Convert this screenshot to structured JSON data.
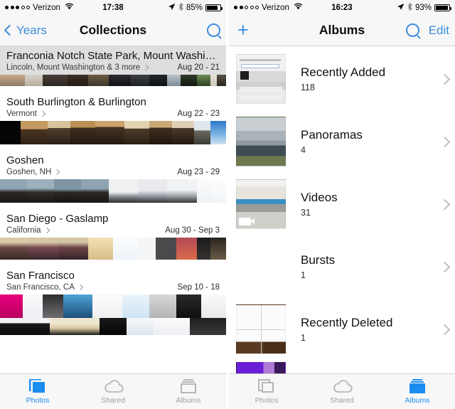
{
  "left": {
    "status": {
      "carrier": "Verizon",
      "bars_filled": 3,
      "bars_total": 5,
      "time": "17:38",
      "battery": "85%",
      "battery_level": 85,
      "wifi_icon": "wifi-icon",
      "location_icon": "location-arrow-icon",
      "bluetooth_icon": "bluetooth-icon"
    },
    "nav": {
      "back_label": "Years",
      "title": "Collections",
      "search_icon": "search-icon",
      "back_icon": "chevron-left-icon"
    },
    "collections": [
      {
        "title": "Franconia Notch State Park, Mount Washing…",
        "location": "Lincoln, Mount Washington & 3 more",
        "date": "Aug 20 - 21",
        "selected": true
      },
      {
        "title": "South Burlington & Burlington",
        "location": "Vermont",
        "date": "Aug 22 - 23",
        "selected": false
      },
      {
        "title": "Goshen",
        "location": "Goshen, NH",
        "date": "Aug 23 - 29",
        "selected": false
      },
      {
        "title": "San Diego - Gaslamp",
        "location": "California",
        "date": "Aug 30 - Sep 3",
        "selected": false
      },
      {
        "title": "San Francisco",
        "location": "San Francisco, CA",
        "date": "Sep 10 - 18",
        "selected": false
      }
    ],
    "tabs": [
      {
        "label": "Photos",
        "icon": "photos-icon",
        "active": true
      },
      {
        "label": "Shared",
        "icon": "cloud-icon",
        "active": false
      },
      {
        "label": "Albums",
        "icon": "albums-icon",
        "active": false
      }
    ]
  },
  "right": {
    "status": {
      "carrier": "Verizon",
      "bars_filled": 2,
      "bars_total": 5,
      "time": "16:23",
      "battery": "93%",
      "battery_level": 93,
      "wifi_icon": "wifi-icon",
      "location_icon": "location-arrow-icon",
      "bluetooth_icon": "bluetooth-icon"
    },
    "nav": {
      "add_label": "+",
      "title": "Albums",
      "search_icon": "search-icon",
      "edit_label": "Edit"
    },
    "albums": [
      {
        "name": "Recently Added",
        "count": "118",
        "thumb": "screenshot-keyboard"
      },
      {
        "name": "Panoramas",
        "count": "4",
        "thumb": "mountain-panorama"
      },
      {
        "name": "Videos",
        "count": "31",
        "thumb": "video-still",
        "video_badge": true
      },
      {
        "name": "Bursts",
        "count": "1",
        "thumb": ""
      },
      {
        "name": "Recently Deleted",
        "count": "1",
        "thumb": "comic-strip"
      }
    ],
    "tabs": [
      {
        "label": "Photos",
        "icon": "photos-icon",
        "active": false
      },
      {
        "label": "Shared",
        "icon": "cloud-icon",
        "active": false
      },
      {
        "label": "Albums",
        "icon": "albums-icon",
        "active": true
      }
    ]
  },
  "colors": {
    "accent": "#1b8cf0",
    "nav_tint": "#3c8ddb",
    "bar_bg": "#f7f7f7",
    "selected_row": "#dedede",
    "inactive": "#a0a0a0"
  }
}
